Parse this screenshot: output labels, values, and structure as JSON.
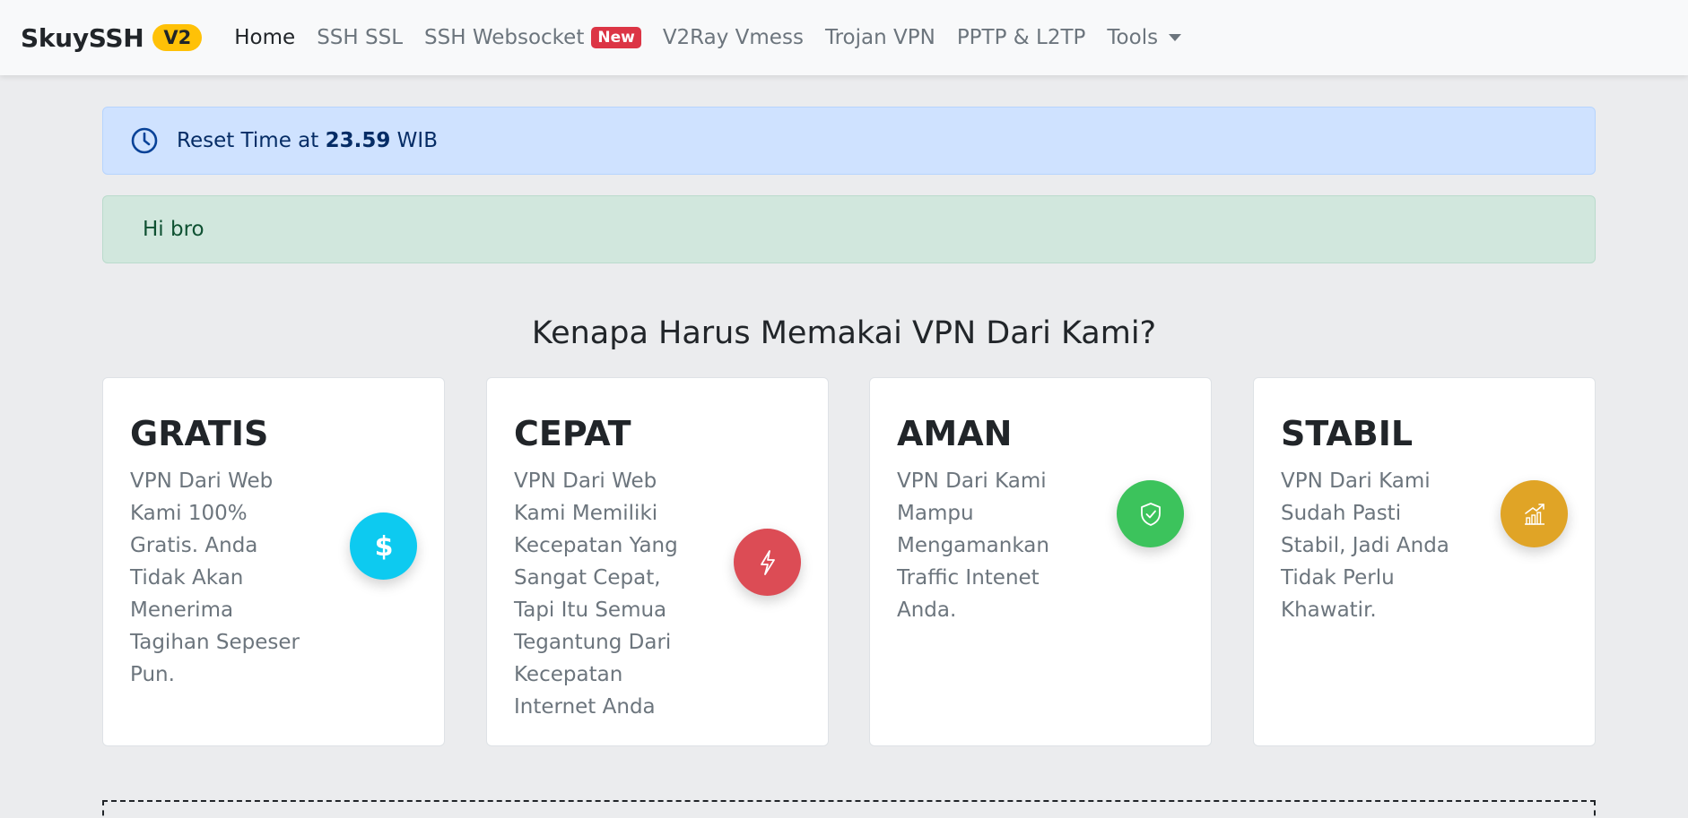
{
  "navbar": {
    "brand": "SkuySSH",
    "brand_badge": "V2",
    "items": [
      {
        "label": "Home",
        "active": true
      },
      {
        "label": "SSH SSL"
      },
      {
        "label": "SSH Websocket",
        "badge": "New"
      },
      {
        "label": "V2Ray Vmess"
      },
      {
        "label": "Trojan VPN"
      },
      {
        "label": "PPTP & L2TP"
      },
      {
        "label": "Tools",
        "dropdown": true
      }
    ]
  },
  "alerts": {
    "info": {
      "prefix": "Reset Time at ",
      "time": "23.59",
      "suffix": " WIB",
      "icon": "clock-icon"
    },
    "success": {
      "text": "Hi bro"
    }
  },
  "section": {
    "title": "Kenapa Harus Memakai VPN Dari Kami?"
  },
  "cards": [
    {
      "title": "GRATIS",
      "text": "VPN Dari Web Kami 100% Gratis. Anda Tidak Akan Menerima Tagihan Sepeser Pun.",
      "icon": "dollar-icon",
      "color": "#0dcaf0"
    },
    {
      "title": "CEPAT",
      "text": "VPN Dari Web Kami Memiliki Kecepatan Yang Sangat Cepat, Tapi Itu Semua Tegantung Dari Kecepatan Internet Anda",
      "icon": "lightning-icon",
      "color": "#dc4c55"
    },
    {
      "title": "AMAN",
      "text": "VPN Dari Kami Mampu Mengamankan Traffic Intenet Anda.",
      "icon": "shield-check-icon",
      "color": "#3cc35c"
    },
    {
      "title": "STABIL",
      "text": "VPN Dari Kami Sudah Pasti Stabil, Jadi Anda Tidak Perlu Khawatir.",
      "icon": "graph-up-icon",
      "color": "#e0a426"
    }
  ],
  "colors": {
    "brand_badge": "#ffc107",
    "new_badge": "#dc3545",
    "info_bg": "#cfe2ff",
    "success_bg": "#d1e7dd"
  }
}
